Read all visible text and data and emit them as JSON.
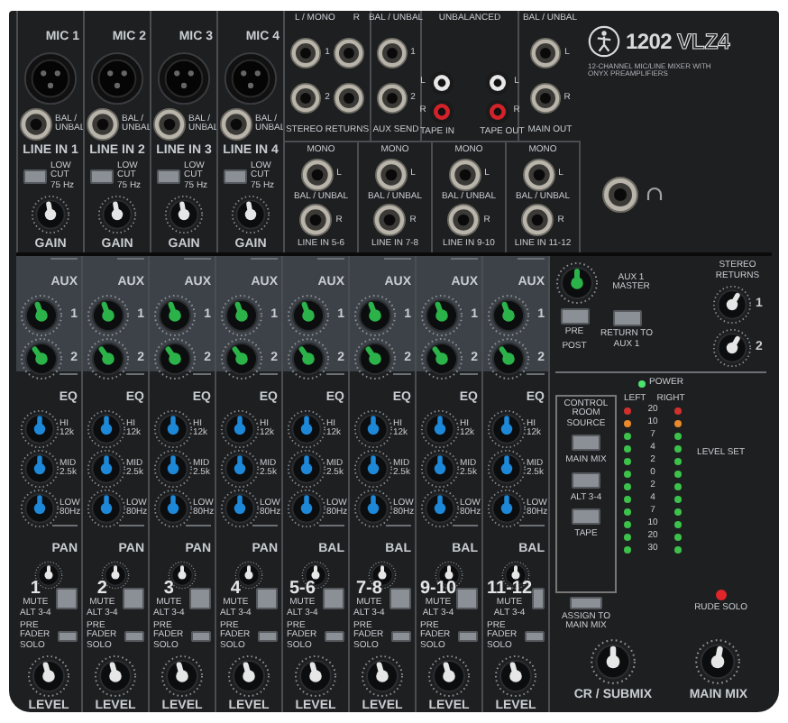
{
  "top": {
    "mic_channels": [
      {
        "mic": "MIC 1",
        "jack_note": "BAL / UNBAL",
        "line": "LINE IN 1",
        "low_cut": "LOW CUT 75 Hz",
        "gain": "GAIN"
      },
      {
        "mic": "MIC 2",
        "jack_note": "BAL / UNBAL",
        "line": "LINE IN 2",
        "low_cut": "LOW CUT 75 Hz",
        "gain": "GAIN"
      },
      {
        "mic": "MIC 3",
        "jack_note": "BAL / UNBAL",
        "line": "LINE IN 3",
        "low_cut": "LOW CUT 75 Hz",
        "gain": "GAIN"
      },
      {
        "mic": "MIC 4",
        "jack_note": "BAL / UNBAL",
        "line": "LINE IN 4",
        "low_cut": "LOW CUT 75 Hz",
        "gain": "GAIN"
      }
    ],
    "stereo_returns": {
      "labels": [
        "L / MONO",
        "R"
      ],
      "rows": [
        "1",
        "2"
      ],
      "title": "STEREO RETURNS"
    },
    "aux_send": {
      "header": "BAL / UNBAL",
      "jacks": [
        "1",
        "2"
      ],
      "title": "AUX SEND"
    },
    "tape": {
      "header": "UNBALANCED",
      "inputs": [
        {
          "title": "TAPE IN",
          "labels": [
            "L",
            "R"
          ]
        },
        {
          "title": "TAPE OUT",
          "labels": [
            "L",
            "R"
          ]
        }
      ]
    },
    "main_out": {
      "header": "BAL / UNBAL",
      "jacks": [
        "L",
        "R"
      ],
      "title": "MAIN OUT"
    },
    "stereo_line_inputs": [
      {
        "header": "MONO",
        "jacks": [
          "L",
          "R"
        ],
        "note": "BAL / UNBAL",
        "title": "LINE IN 5-6"
      },
      {
        "header": "MONO",
        "jacks": [
          "L",
          "R"
        ],
        "note": "BAL / UNBAL",
        "title": "LINE IN 7-8"
      },
      {
        "header": "MONO",
        "jacks": [
          "L",
          "R"
        ],
        "note": "BAL / UNBAL",
        "title": "LINE IN 9-10"
      },
      {
        "header": "MONO",
        "jacks": [
          "L",
          "R"
        ],
        "note": "BAL / UNBAL",
        "title": "LINE IN 11-12"
      }
    ],
    "logo": {
      "model": "1202",
      "model_suffix": "VLZ4",
      "subtitle": "12-CHANNEL MIC/LINE MIXER WITH ONYX PREAMPLIFIERS"
    }
  },
  "strips": [
    {
      "aux_header": "AUX",
      "aux": [
        "1",
        "2"
      ],
      "eq_header": "EQ",
      "eq": [
        "HI 12k",
        "MID 2.5k",
        "LOW 80Hz"
      ],
      "pan": "PAN",
      "number": "1",
      "mute_label": "MUTE",
      "mute_sub": "ALT 3-4",
      "solo": "PRE FADER SOLO",
      "fader": "LEVEL"
    },
    {
      "aux_header": "AUX",
      "aux": [
        "1",
        "2"
      ],
      "eq_header": "EQ",
      "eq": [
        "HI 12k",
        "MID 2.5k",
        "LOW 80Hz"
      ],
      "pan": "PAN",
      "number": "2",
      "mute_label": "MUTE",
      "mute_sub": "ALT 3-4",
      "solo": "PRE FADER SOLO",
      "fader": "LEVEL"
    },
    {
      "aux_header": "AUX",
      "aux": [
        "1",
        "2"
      ],
      "eq_header": "EQ",
      "eq": [
        "HI 12k",
        "MID 2.5k",
        "LOW 80Hz"
      ],
      "pan": "PAN",
      "number": "3",
      "mute_label": "MUTE",
      "mute_sub": "ALT 3-4",
      "solo": "PRE FADER SOLO",
      "fader": "LEVEL"
    },
    {
      "aux_header": "AUX",
      "aux": [
        "1",
        "2"
      ],
      "eq_header": "EQ",
      "eq": [
        "HI 12k",
        "MID 2.5k",
        "LOW 80Hz"
      ],
      "pan": "PAN",
      "number": "4",
      "mute_label": "MUTE",
      "mute_sub": "ALT 3-4",
      "solo": "PRE FADER SOLO",
      "fader": "LEVEL"
    },
    {
      "aux_header": "AUX",
      "aux": [
        "1",
        "2"
      ],
      "eq_header": "EQ",
      "eq": [
        "HI 12k",
        "MID 2.5k",
        "LOW 80Hz"
      ],
      "pan": "BAL",
      "number": "5-6",
      "mute_label": "MUTE",
      "mute_sub": "ALT 3-4",
      "solo": "PRE FADER SOLO",
      "fader": "LEVEL"
    },
    {
      "aux_header": "AUX",
      "aux": [
        "1",
        "2"
      ],
      "eq_header": "EQ",
      "eq": [
        "HI 12k",
        "MID 2.5k",
        "LOW 80Hz"
      ],
      "pan": "BAL",
      "number": "7-8",
      "mute_label": "MUTE",
      "mute_sub": "ALT 3-4",
      "solo": "PRE FADER SOLO",
      "fader": "LEVEL"
    },
    {
      "aux_header": "AUX",
      "aux": [
        "1",
        "2"
      ],
      "eq_header": "EQ",
      "eq": [
        "HI 12k",
        "MID 2.5k",
        "LOW 80Hz"
      ],
      "pan": "BAL",
      "number": "9-10",
      "mute_label": "MUTE",
      "mute_sub": "ALT 3-4",
      "solo": "PRE FADER SOLO",
      "fader": "LEVEL"
    },
    {
      "aux_header": "AUX",
      "aux": [
        "1",
        "2"
      ],
      "eq_header": "EQ",
      "eq": [
        "HI 12k",
        "MID 2.5k",
        "LOW 80Hz"
      ],
      "pan": "BAL",
      "number": "11-12",
      "mute_label": "MUTE",
      "mute_sub": "ALT 3-4",
      "solo": "PRE FADER SOLO",
      "fader": "LEVEL"
    }
  ],
  "master": {
    "aux_master": "AUX 1 MASTER",
    "returns": {
      "label": "STEREO RETURNS",
      "knobs": [
        "1",
        "2"
      ]
    },
    "pre_post": [
      "PRE",
      "POST"
    ],
    "return_to_aux": "RETURN TO AUX 1",
    "power": {
      "label": "POWER",
      "on": true
    },
    "control_room": {
      "title": "CONTROL ROOM SOURCE",
      "buttons": [
        "MAIN MIX",
        "ALT 3-4",
        "TAPE"
      ]
    },
    "assign": "ASSIGN TO MAIN MIX",
    "meter": {
      "headers": [
        "LEFT",
        "RIGHT"
      ],
      "segments": [
        {
          "label": "20",
          "color": "#d0312d"
        },
        {
          "label": "10",
          "color": "#e88a2a"
        },
        {
          "label": "7",
          "color": "#3cc24a"
        },
        {
          "label": "4",
          "color": "#3cc24a"
        },
        {
          "label": "2",
          "color": "#3cc24a"
        },
        {
          "label": "0",
          "color": "#3cc24a"
        },
        {
          "label": "2",
          "color": "#3cc24a"
        },
        {
          "label": "4",
          "color": "#3cc24a"
        },
        {
          "label": "7",
          "color": "#3cc24a"
        },
        {
          "label": "10",
          "color": "#3cc24a"
        },
        {
          "label": "20",
          "color": "#3cc24a"
        },
        {
          "label": "30",
          "color": "#3cc24a"
        }
      ]
    },
    "level_set": "LEVEL SET",
    "rude_solo": {
      "label": "RUDE SOLO",
      "on": true
    },
    "cr_submix": "CR / SUBMIX",
    "main_mix": "MAIN MIX"
  }
}
